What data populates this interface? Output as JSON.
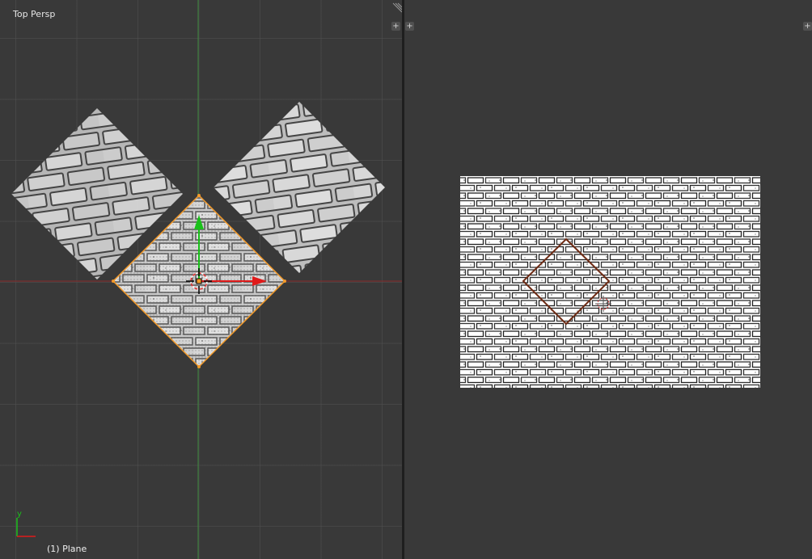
{
  "viewport_3d": {
    "view_name": "Top Persp",
    "active_object": "(1) Plane",
    "axis_label_y": "y",
    "colors": {
      "background": "#393939",
      "grid": "#4f4f4f",
      "x_axis": "#8a2a2a",
      "y_axis": "#3d8a3d",
      "selection": "#f39a2a",
      "gizmo_x": "#e01a1a",
      "gizmo_y": "#1ac01a"
    },
    "icons": [
      "area-split-icon",
      "transform-manipulator-icon",
      "3d-cursor-icon",
      "axis-indicator-icon"
    ]
  },
  "uv_editor": {
    "colors": {
      "background": "#393939",
      "uv_outline": "#6e2b14"
    },
    "icons": [
      "area-split-icon",
      "2d-cursor-icon"
    ]
  },
  "corner_widget_glyph": "+"
}
